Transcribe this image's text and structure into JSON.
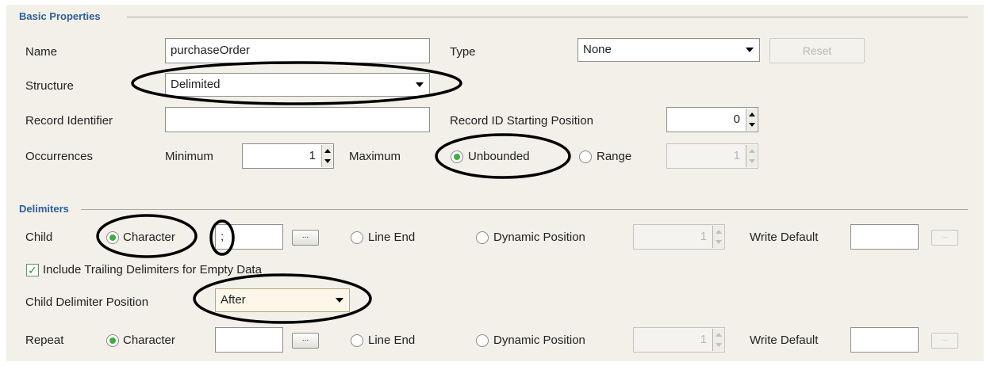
{
  "basic": {
    "title": "Basic Properties",
    "name_label": "Name",
    "name_value": "purchaseOrder",
    "type_label": "Type",
    "type_value": "None",
    "reset_label": "Reset",
    "structure_label": "Structure",
    "structure_value": "Delimited",
    "record_id_label": "Record Identifier",
    "record_id_value": "",
    "start_pos_label": "Record ID Starting Position",
    "start_pos_value": "0",
    "occurrences_label": "Occurrences",
    "minimum_label": "Minimum",
    "minimum_value": "1",
    "maximum_label": "Maximum",
    "unbounded_label": "Unbounded",
    "range_label": "Range",
    "range_value": "1"
  },
  "delimiters": {
    "title": "Delimiters",
    "child_label": "Child",
    "character_label": "Character",
    "child_char_value": ";",
    "browse_label": "...",
    "line_end_label": "Line End",
    "dynamic_label": "Dynamic Position",
    "dynamic_value": "1",
    "write_default_label": "Write Default",
    "write_default_value": "",
    "include_trailing_label": "Include Trailing Delimiters for Empty Data",
    "include_trailing_checked": true,
    "child_pos_label": "Child Delimiter Position",
    "child_pos_value": "After",
    "repeat_label": "Repeat",
    "repeat_character_label": "Character",
    "repeat_char_value": "",
    "repeat_line_end_label": "Line End",
    "repeat_dynamic_label": "Dynamic Position",
    "repeat_dynamic_value": "1",
    "repeat_write_default_label": "Write Default",
    "repeat_write_default_value": ""
  },
  "colors": {
    "accent_title": "#2e5f9a",
    "radio_on": "#3fae3f",
    "annotation": "#000000"
  }
}
